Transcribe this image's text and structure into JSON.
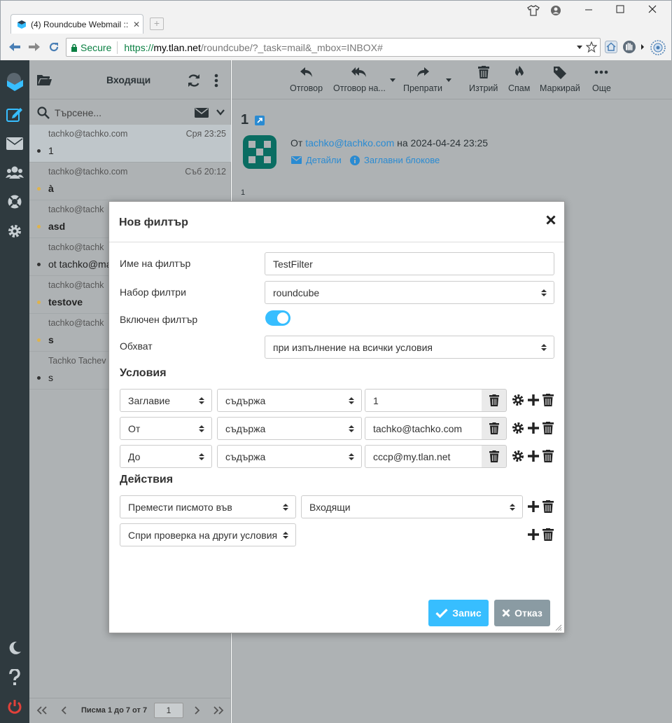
{
  "browser": {
    "tab_title": "(4) Roundcube Webmail ::",
    "secure_label": "Secure",
    "url_scheme": "https://",
    "url_host": "my.tlan.net",
    "url_rest": "/roundcube/?_task=mail&_mbox=INBOX#"
  },
  "list": {
    "folder_title": "Входящи",
    "search_placeholder": "Търсене...",
    "messages": [
      {
        "from": "tachko@tachko.com",
        "date": "Сря 23:25",
        "subject": "1",
        "dot": "#333333"
      },
      {
        "from": "tachko@tachko.com",
        "date": "Съб 20:12",
        "subject": "à",
        "dot": "#e0b34a"
      },
      {
        "from": "tachko@tachk",
        "date": "",
        "subject": "asd",
        "dot": "#e0b34a"
      },
      {
        "from": "tachko@tachk",
        "date": "",
        "subject": "ot tachko@ma",
        "dot": "#333333"
      },
      {
        "from": "tachko@tachk",
        "date": "",
        "subject": "testove",
        "dot": "#e0b34a"
      },
      {
        "from": "tachko@tachk",
        "date": "",
        "subject": "s",
        "dot": "#e0b34a"
      },
      {
        "from": "Tachko Tachev",
        "date": "",
        "subject": "s",
        "dot": "#333333"
      }
    ],
    "pager_text": "Писма 1 до 7 от 7",
    "page_number": "1"
  },
  "toolbar": {
    "reply": "Отговор",
    "reply_all": "Отговор на...",
    "forward": "Препрати",
    "delete": "Изтрий",
    "spam": "Спам",
    "mark": "Маркирай",
    "more": "Още"
  },
  "message": {
    "subject": "1",
    "from_prefix": "От",
    "from_email": "tachko@tachko.com",
    "date_text": "на 2024-04-24 23:25",
    "details_link": "Детайли",
    "headers_link": "Заглавни блокове",
    "body": "1"
  },
  "dialog": {
    "title": "Нов филтър",
    "name_label": "Име на филтър",
    "name_value": "TestFilter",
    "set_label": "Набор филтри",
    "set_value": "roundcube",
    "enabled_label": "Включен филтър",
    "enabled": true,
    "scope_label": "Обхват",
    "scope_value": "при изпълнение на всички условия",
    "conditions_title": "Условия",
    "conditions": [
      {
        "header": "Заглавие",
        "op": "съдържа",
        "value": "1"
      },
      {
        "header": "От",
        "op": "съдържа",
        "value": "tachko@tachko.com"
      },
      {
        "header": "До",
        "op": "съдържа",
        "value": "cccp@my.tlan.net"
      }
    ],
    "actions_title": "Действия",
    "actions": [
      {
        "type": "Премести писмото във",
        "target": "Входящи"
      },
      {
        "type": "Спри проверка на други условия",
        "target": ""
      }
    ],
    "save_label": "Запис",
    "cancel_label": "Отказ"
  },
  "colors": {
    "accent": "#37beff",
    "link": "#2a8bd2",
    "rail": "#2f3a3f",
    "cancel": "#8a9ba3",
    "logout": "#e2413a"
  }
}
